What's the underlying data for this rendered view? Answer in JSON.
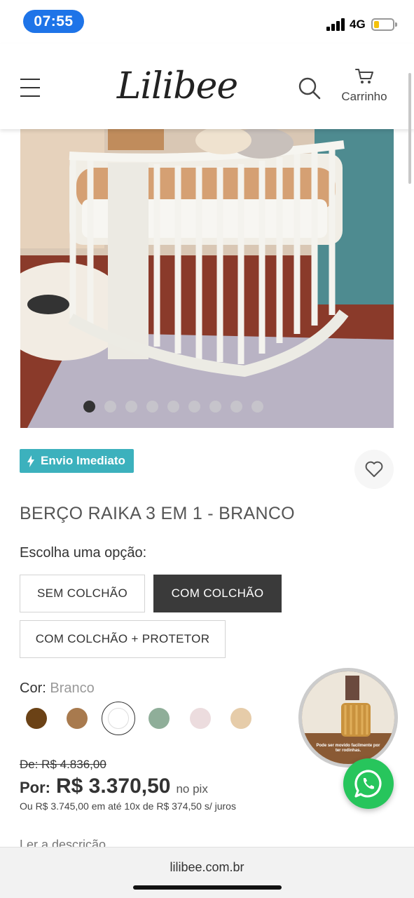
{
  "status_bar": {
    "time": "07:55",
    "network": "4G"
  },
  "header": {
    "logo": "Lilibee",
    "cart_label": "Carrinho"
  },
  "gallery": {
    "total_images": 9,
    "active_index": 0
  },
  "badge": {
    "label": "Envio Imediato",
    "color": "#3cb1bd"
  },
  "product": {
    "title": "BERÇO RAIKA 3 EM 1 - BRANCO"
  },
  "options": {
    "label": "Escolha uma opção:",
    "items": [
      {
        "label": "SEM COLCHÃO",
        "selected": false
      },
      {
        "label": "COM COLCHÃO",
        "selected": true
      },
      {
        "label": "COM COLCHÃO + PROTETOR",
        "selected": false
      }
    ]
  },
  "color": {
    "label": "Cor:",
    "selected": "Branco",
    "swatches": [
      "#6b4216",
      "#a87a4e",
      "#ffffff",
      "#8fae99",
      "#ecdcde",
      "#e6cca9"
    ]
  },
  "video": {
    "caption": "Pode ser movido facilmente por ter rodinhas."
  },
  "price": {
    "old": "De: R$ 4.836,00",
    "prefix": "Por:",
    "current": "R$ 3.370,50",
    "suffix": "no pix",
    "installments": "Ou R$ 3.745,00 em até 10x de R$ 374,50 s/ juros"
  },
  "read_description": "Ler a descrição",
  "browser": {
    "url": "lilibee.com.br"
  }
}
